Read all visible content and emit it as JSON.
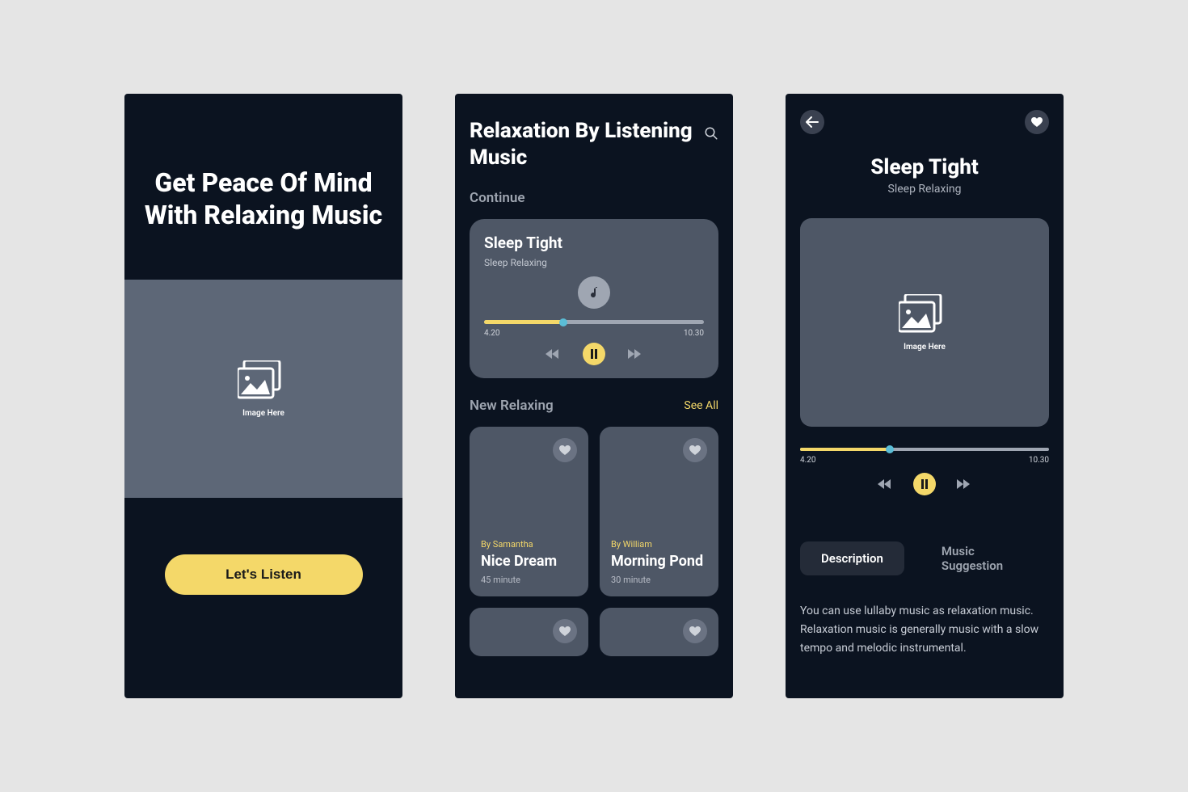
{
  "screen1": {
    "title": "Get Peace Of Mind With Relaxing Music",
    "image_label": "Image Here",
    "cta": "Let's Listen"
  },
  "screen2": {
    "title": "Relaxation By Listening Music",
    "continue_label": "Continue",
    "continue_card": {
      "title": "Sleep Tight",
      "subtitle": "Sleep Relaxing",
      "time_current": "4.20",
      "time_total": "10.30"
    },
    "new_label": "New Relaxing",
    "see_all": "See All",
    "items": [
      {
        "author": "By Samantha",
        "title": "Nice Dream",
        "duration": "45 minute"
      },
      {
        "author": "By William",
        "title": "Morning Pond",
        "duration": "30 minute"
      }
    ]
  },
  "screen3": {
    "title": "Sleep Tight",
    "subtitle": "Sleep Relaxing",
    "image_label": "Image Here",
    "time_current": "4.20",
    "time_total": "10.30",
    "tab_description": "Description",
    "tab_suggestion": "Music Suggestion",
    "description_text": "You can use lullaby music as relaxation music. Relaxation music is generally music with a slow tempo and melodic instrumental."
  }
}
